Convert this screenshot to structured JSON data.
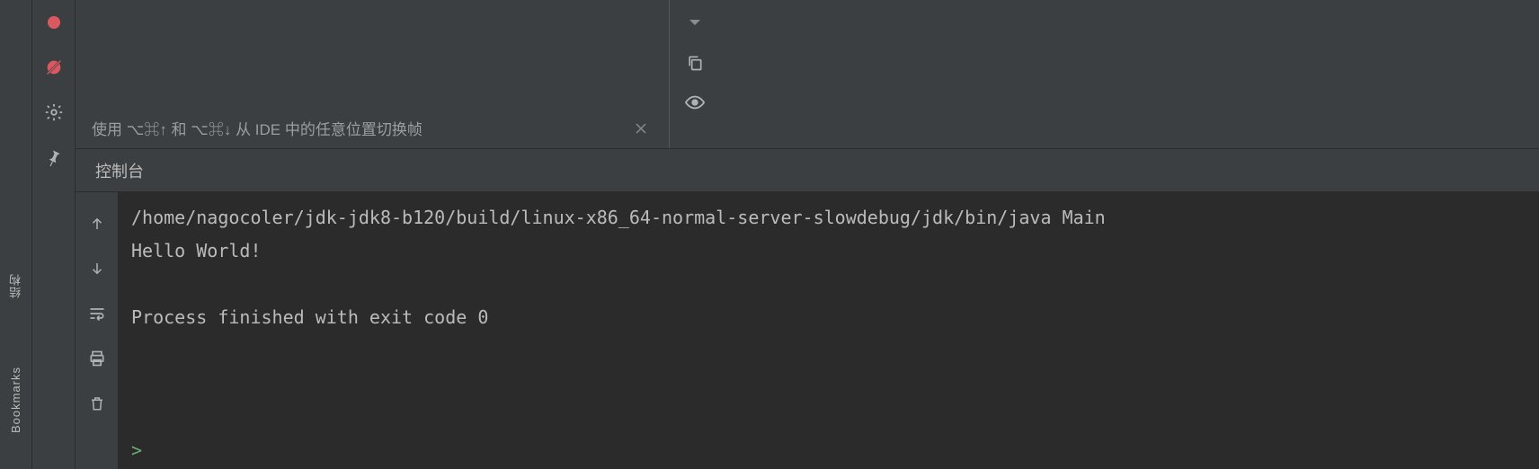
{
  "gutter": {
    "structure_label": "结构",
    "bookmarks_label": "Bookmarks"
  },
  "frames": {
    "hint": "使用 ⌥⌘↑ 和 ⌥⌘↓ 从 IDE 中的任意位置切换帧"
  },
  "tabs": {
    "console": "控制台"
  },
  "console": {
    "line1": "/home/nagocoler/jdk-jdk8-b120/build/linux-x86_64-normal-server-slowdebug/jdk/bin/java Main",
    "line2": "Hello World!",
    "line3": "",
    "line4": "Process finished with exit code 0",
    "prompt": ">"
  },
  "icons": {
    "stop": "stop-icon",
    "mute": "mute-breakpoints-icon",
    "settings": "gear-icon",
    "pin": "pin-icon",
    "collapse": "collapse-icon",
    "copy": "copy-icon",
    "eye": "eye-icon",
    "close": "close-icon",
    "up": "up-arrow-icon",
    "down": "down-arrow-icon",
    "wrap": "soft-wrap-icon",
    "print": "print-icon",
    "trash": "trash-icon"
  }
}
